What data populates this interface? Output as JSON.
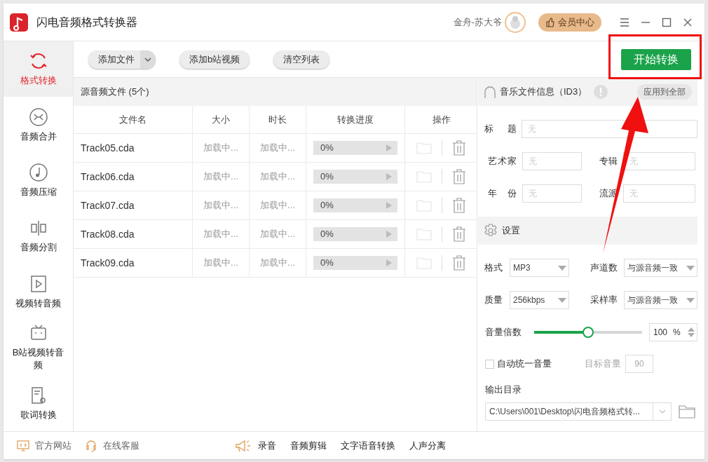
{
  "window": {
    "title": "闪电音频格式转换器",
    "user_name": "金舟-苏大爷",
    "vip_button": "会员中心"
  },
  "sidebar": {
    "items": [
      {
        "label": "格式转换",
        "selected": true,
        "kind": "convert"
      },
      {
        "label": "音频合并",
        "selected": false,
        "kind": "merge"
      },
      {
        "label": "音频压缩",
        "selected": false,
        "kind": "compress"
      },
      {
        "label": "音频分割",
        "selected": false,
        "kind": "split"
      },
      {
        "label": "视频转音频",
        "selected": false,
        "kind": "video"
      },
      {
        "label": "B站视频转音频",
        "selected": false,
        "kind": "bilibili"
      },
      {
        "label": "歌词转换",
        "selected": false,
        "kind": "lyrics"
      }
    ]
  },
  "toolbar": {
    "add_file": "添加文件",
    "add_bilibili": "添加b站视频",
    "clear_list": "清空列表",
    "start": "开始转换"
  },
  "file_list": {
    "title": "源音频文件 (5个)",
    "columns": [
      "文件名",
      "大小",
      "时长",
      "转换进度",
      "操作"
    ],
    "rows": [
      {
        "name": "Track05.cda",
        "size": "加载中...",
        "duration": "加载中...",
        "progress": "0%",
        "level": 0
      },
      {
        "name": "Track06.cda",
        "size": "加载中...",
        "duration": "加载中...",
        "progress": "0%",
        "level": 0
      },
      {
        "name": "Track07.cda",
        "size": "加载中...",
        "duration": "加载中...",
        "progress": "0%",
        "level": 0
      },
      {
        "name": "Track08.cda",
        "size": "加载中...",
        "duration": "加载中...",
        "progress": "0%",
        "level": 0
      },
      {
        "name": "Track09.cda",
        "size": "加载中...",
        "duration": "加载中...",
        "progress": "0%",
        "level": 0
      }
    ]
  },
  "id3": {
    "title": "音乐文件信息（ID3）",
    "apply_all": "应用到全部",
    "fields": [
      {
        "label": "标题",
        "placeholder": "无",
        "kind": "wide"
      },
      {
        "label": "艺术家",
        "placeholder": "无",
        "kind": "half"
      },
      {
        "label": "专辑",
        "placeholder": "无",
        "kind": "half"
      },
      {
        "label": "年份",
        "placeholder": "无",
        "kind": "half"
      },
      {
        "label": "流派",
        "placeholder": "无",
        "kind": "half"
      }
    ]
  },
  "settings": {
    "title": "设置",
    "selects": [
      {
        "label": "格式",
        "value": "MP3"
      },
      {
        "label": "声道数",
        "value": "与源音频一致"
      },
      {
        "label": "质量",
        "value": "256kbps"
      },
      {
        "label": "采样率",
        "value": "与源音频一致"
      }
    ],
    "volume": {
      "label": "音量倍数",
      "level": 0.5,
      "value": "100",
      "unit": "%"
    },
    "auto_normalize": {
      "label": "自动统一音量",
      "checked": false
    },
    "target_volume": {
      "label": "目标音量",
      "value": "90",
      "disabled": true
    },
    "output": {
      "label": "输出目录",
      "path": "C:\\Users\\001\\Desktop\\闪电音频格式转..."
    }
  },
  "footer": {
    "links": [
      {
        "label": "官方网站",
        "kind": "web"
      },
      {
        "label": "在线客服",
        "kind": "support"
      }
    ],
    "tools": [
      "录音",
      "音频剪辑",
      "文字语音转换",
      "人声分离"
    ]
  },
  "annotation": {
    "highlight_box": true,
    "arrow": true
  }
}
